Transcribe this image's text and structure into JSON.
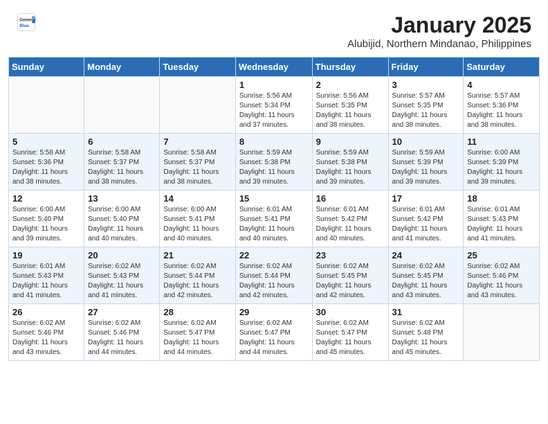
{
  "header": {
    "logo": {
      "general": "General",
      "blue": "Blue"
    },
    "title": "January 2025",
    "subtitle": "Alubijid, Northern Mindanao, Philippines"
  },
  "weekdays": [
    "Sunday",
    "Monday",
    "Tuesday",
    "Wednesday",
    "Thursday",
    "Friday",
    "Saturday"
  ],
  "weeks": [
    [
      {
        "day": "",
        "info": ""
      },
      {
        "day": "",
        "info": ""
      },
      {
        "day": "",
        "info": ""
      },
      {
        "day": "1",
        "info": "Sunrise: 5:56 AM\nSunset: 5:34 PM\nDaylight: 11 hours\nand 37 minutes."
      },
      {
        "day": "2",
        "info": "Sunrise: 5:56 AM\nSunset: 5:35 PM\nDaylight: 11 hours\nand 38 minutes."
      },
      {
        "day": "3",
        "info": "Sunrise: 5:57 AM\nSunset: 5:35 PM\nDaylight: 11 hours\nand 38 minutes."
      },
      {
        "day": "4",
        "info": "Sunrise: 5:57 AM\nSunset: 5:36 PM\nDaylight: 11 hours\nand 38 minutes."
      }
    ],
    [
      {
        "day": "5",
        "info": "Sunrise: 5:58 AM\nSunset: 5:36 PM\nDaylight: 11 hours\nand 38 minutes."
      },
      {
        "day": "6",
        "info": "Sunrise: 5:58 AM\nSunset: 5:37 PM\nDaylight: 11 hours\nand 38 minutes."
      },
      {
        "day": "7",
        "info": "Sunrise: 5:58 AM\nSunset: 5:37 PM\nDaylight: 11 hours\nand 38 minutes."
      },
      {
        "day": "8",
        "info": "Sunrise: 5:59 AM\nSunset: 5:38 PM\nDaylight: 11 hours\nand 39 minutes."
      },
      {
        "day": "9",
        "info": "Sunrise: 5:59 AM\nSunset: 5:38 PM\nDaylight: 11 hours\nand 39 minutes."
      },
      {
        "day": "10",
        "info": "Sunrise: 5:59 AM\nSunset: 5:39 PM\nDaylight: 11 hours\nand 39 minutes."
      },
      {
        "day": "11",
        "info": "Sunrise: 6:00 AM\nSunset: 5:39 PM\nDaylight: 11 hours\nand 39 minutes."
      }
    ],
    [
      {
        "day": "12",
        "info": "Sunrise: 6:00 AM\nSunset: 5:40 PM\nDaylight: 11 hours\nand 39 minutes."
      },
      {
        "day": "13",
        "info": "Sunrise: 6:00 AM\nSunset: 5:40 PM\nDaylight: 11 hours\nand 40 minutes."
      },
      {
        "day": "14",
        "info": "Sunrise: 6:00 AM\nSunset: 5:41 PM\nDaylight: 11 hours\nand 40 minutes."
      },
      {
        "day": "15",
        "info": "Sunrise: 6:01 AM\nSunset: 5:41 PM\nDaylight: 11 hours\nand 40 minutes."
      },
      {
        "day": "16",
        "info": "Sunrise: 6:01 AM\nSunset: 5:42 PM\nDaylight: 11 hours\nand 40 minutes."
      },
      {
        "day": "17",
        "info": "Sunrise: 6:01 AM\nSunset: 5:42 PM\nDaylight: 11 hours\nand 41 minutes."
      },
      {
        "day": "18",
        "info": "Sunrise: 6:01 AM\nSunset: 5:43 PM\nDaylight: 11 hours\nand 41 minutes."
      }
    ],
    [
      {
        "day": "19",
        "info": "Sunrise: 6:01 AM\nSunset: 5:43 PM\nDaylight: 11 hours\nand 41 minutes."
      },
      {
        "day": "20",
        "info": "Sunrise: 6:02 AM\nSunset: 5:43 PM\nDaylight: 11 hours\nand 41 minutes."
      },
      {
        "day": "21",
        "info": "Sunrise: 6:02 AM\nSunset: 5:44 PM\nDaylight: 11 hours\nand 42 minutes."
      },
      {
        "day": "22",
        "info": "Sunrise: 6:02 AM\nSunset: 5:44 PM\nDaylight: 11 hours\nand 42 minutes."
      },
      {
        "day": "23",
        "info": "Sunrise: 6:02 AM\nSunset: 5:45 PM\nDaylight: 11 hours\nand 42 minutes."
      },
      {
        "day": "24",
        "info": "Sunrise: 6:02 AM\nSunset: 5:45 PM\nDaylight: 11 hours\nand 43 minutes."
      },
      {
        "day": "25",
        "info": "Sunrise: 6:02 AM\nSunset: 5:46 PM\nDaylight: 11 hours\nand 43 minutes."
      }
    ],
    [
      {
        "day": "26",
        "info": "Sunrise: 6:02 AM\nSunset: 5:46 PM\nDaylight: 11 hours\nand 43 minutes."
      },
      {
        "day": "27",
        "info": "Sunrise: 6:02 AM\nSunset: 5:46 PM\nDaylight: 11 hours\nand 44 minutes."
      },
      {
        "day": "28",
        "info": "Sunrise: 6:02 AM\nSunset: 5:47 PM\nDaylight: 11 hours\nand 44 minutes."
      },
      {
        "day": "29",
        "info": "Sunrise: 6:02 AM\nSunset: 5:47 PM\nDaylight: 11 hours\nand 44 minutes."
      },
      {
        "day": "30",
        "info": "Sunrise: 6:02 AM\nSunset: 5:47 PM\nDaylight: 11 hours\nand 45 minutes."
      },
      {
        "day": "31",
        "info": "Sunrise: 6:02 AM\nSunset: 5:48 PM\nDaylight: 11 hours\nand 45 minutes."
      },
      {
        "day": "",
        "info": ""
      }
    ]
  ]
}
